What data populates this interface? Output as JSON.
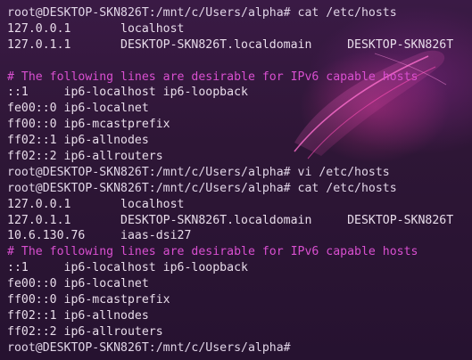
{
  "terminal": {
    "lines": [
      {
        "kind": "prompt",
        "text": "root@DESKTOP-SKN826T:/mnt/c/Users/alpha# cat /etc/hosts"
      },
      {
        "kind": "plain",
        "text": "127.0.0.1       localhost"
      },
      {
        "kind": "plain",
        "text": "127.0.1.1       DESKTOP-SKN826T.localdomain     DESKTOP-SKN826T"
      },
      {
        "kind": "plain",
        "text": ""
      },
      {
        "kind": "comment",
        "text": "# The following lines are desirable for IPv6 capable hosts"
      },
      {
        "kind": "plain",
        "text": "::1     ip6-localhost ip6-loopback"
      },
      {
        "kind": "plain",
        "text": "fe00::0 ip6-localnet"
      },
      {
        "kind": "plain",
        "text": "ff00::0 ip6-mcastprefix"
      },
      {
        "kind": "plain",
        "text": "ff02::1 ip6-allnodes"
      },
      {
        "kind": "plain",
        "text": "ff02::2 ip6-allrouters"
      },
      {
        "kind": "prompt",
        "text": "root@DESKTOP-SKN826T:/mnt/c/Users/alpha# vi /etc/hosts"
      },
      {
        "kind": "prompt",
        "text": "root@DESKTOP-SKN826T:/mnt/c/Users/alpha# cat /etc/hosts"
      },
      {
        "kind": "plain",
        "text": "127.0.0.1       localhost"
      },
      {
        "kind": "plain",
        "text": "127.0.1.1       DESKTOP-SKN826T.localdomain     DESKTOP-SKN826T"
      },
      {
        "kind": "plain",
        "text": "10.6.130.76     iaas-dsi27"
      },
      {
        "kind": "comment",
        "text": "# The following lines are desirable for IPv6 capable hosts"
      },
      {
        "kind": "plain",
        "text": "::1     ip6-localhost ip6-loopback"
      },
      {
        "kind": "plain",
        "text": "fe00::0 ip6-localnet"
      },
      {
        "kind": "plain",
        "text": "ff00::0 ip6-mcastprefix"
      },
      {
        "kind": "plain",
        "text": "ff02::1 ip6-allnodes"
      },
      {
        "kind": "plain",
        "text": "ff02::2 ip6-allrouters"
      },
      {
        "kind": "prompt",
        "text": "root@DESKTOP-SKN826T:/mnt/c/Users/alpha#"
      }
    ]
  },
  "colors": {
    "background": "#2e1636",
    "text": "#e8dcea",
    "comment": "#d94fd0",
    "wallpaper_accent": "#ff3caa"
  },
  "icons": {
    "wallpaper": "neon-streak-wallpaper"
  }
}
